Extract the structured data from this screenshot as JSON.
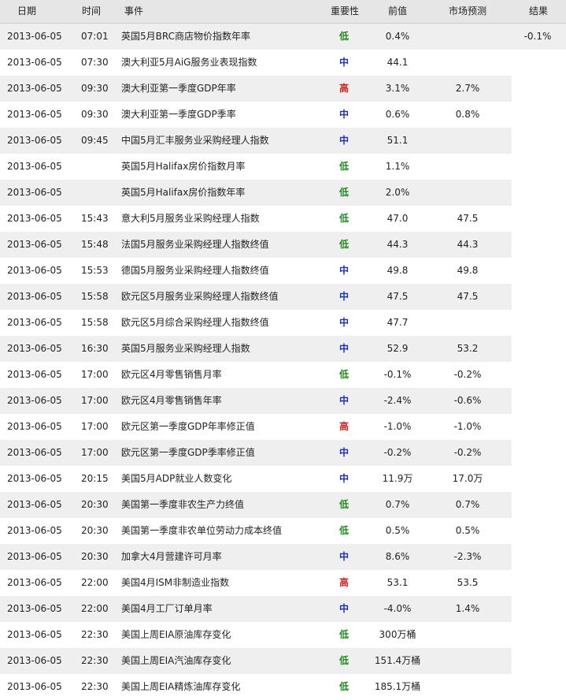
{
  "header": {
    "date": "日期",
    "time": "时间",
    "event": "事件",
    "importance": "重要性",
    "previous": "前值",
    "forecast": "市场预测",
    "result": "结果"
  },
  "importance_colors": {
    "低": "#1d8a1d",
    "中": "#1a2fbb",
    "高": "#d21e1e"
  },
  "rows": [
    {
      "date": "2013-06-05",
      "time": "07:01",
      "event": "英国5月BRC商店物价指数年率",
      "importance": "低",
      "previous": "0.4%",
      "forecast": "",
      "result": "-0.1%"
    },
    {
      "date": "2013-06-05",
      "time": "07:30",
      "event": "澳大利亚5月AiG服务业表现指数",
      "importance": "中",
      "previous": "44.1",
      "forecast": "",
      "result": ""
    },
    {
      "date": "2013-06-05",
      "time": "09:30",
      "event": "澳大利亚第一季度GDP年率",
      "importance": "高",
      "previous": "3.1%",
      "forecast": "2.7%",
      "result": ""
    },
    {
      "date": "2013-06-05",
      "time": "09:30",
      "event": "澳大利亚第一季度GDP季率",
      "importance": "中",
      "previous": "0.6%",
      "forecast": "0.8%",
      "result": ""
    },
    {
      "date": "2013-06-05",
      "time": "09:45",
      "event": "中国5月汇丰服务业采购经理人指数",
      "importance": "中",
      "previous": "51.1",
      "forecast": "",
      "result": ""
    },
    {
      "date": "2013-06-05",
      "time": "",
      "event": "英国5月Halifax房价指数月率",
      "importance": "低",
      "previous": "1.1%",
      "forecast": "",
      "result": ""
    },
    {
      "date": "2013-06-05",
      "time": "",
      "event": "英国5月Halifax房价指数年率",
      "importance": "低",
      "previous": "2.0%",
      "forecast": "",
      "result": ""
    },
    {
      "date": "2013-06-05",
      "time": "15:43",
      "event": "意大利5月服务业采购经理人指数",
      "importance": "低",
      "previous": "47.0",
      "forecast": "47.5",
      "result": ""
    },
    {
      "date": "2013-06-05",
      "time": "15:48",
      "event": "法国5月服务业采购经理人指数终值",
      "importance": "低",
      "previous": "44.3",
      "forecast": "44.3",
      "result": ""
    },
    {
      "date": "2013-06-05",
      "time": "15:53",
      "event": "德国5月服务业采购经理人指数终值",
      "importance": "中",
      "previous": "49.8",
      "forecast": "49.8",
      "result": ""
    },
    {
      "date": "2013-06-05",
      "time": "15:58",
      "event": "欧元区5月服务业采购经理人指数终值",
      "importance": "中",
      "previous": "47.5",
      "forecast": "47.5",
      "result": ""
    },
    {
      "date": "2013-06-05",
      "time": "15:58",
      "event": "欧元区5月综合采购经理人指数终值",
      "importance": "中",
      "previous": "47.7",
      "forecast": "",
      "result": ""
    },
    {
      "date": "2013-06-05",
      "time": "16:30",
      "event": "英国5月服务业采购经理人指数",
      "importance": "中",
      "previous": "52.9",
      "forecast": "53.2",
      "result": ""
    },
    {
      "date": "2013-06-05",
      "time": "17:00",
      "event": "欧元区4月零售销售月率",
      "importance": "低",
      "previous": "-0.1%",
      "forecast": "-0.2%",
      "result": ""
    },
    {
      "date": "2013-06-05",
      "time": "17:00",
      "event": "欧元区4月零售销售年率",
      "importance": "中",
      "previous": "-2.4%",
      "forecast": "-0.6%",
      "result": ""
    },
    {
      "date": "2013-06-05",
      "time": "17:00",
      "event": "欧元区第一季度GDP年率修正值",
      "importance": "高",
      "previous": "-1.0%",
      "forecast": "-1.0%",
      "result": ""
    },
    {
      "date": "2013-06-05",
      "time": "17:00",
      "event": "欧元区第一季度GDP季率修正值",
      "importance": "中",
      "previous": "-0.2%",
      "forecast": "-0.2%",
      "result": ""
    },
    {
      "date": "2013-06-05",
      "time": "20:15",
      "event": "美国5月ADP就业人数变化",
      "importance": "中",
      "previous": "11.9万",
      "forecast": "17.0万",
      "result": ""
    },
    {
      "date": "2013-06-05",
      "time": "20:30",
      "event": "美国第一季度非农生产力终值",
      "importance": "低",
      "previous": "0.7%",
      "forecast": "0.7%",
      "result": ""
    },
    {
      "date": "2013-06-05",
      "time": "20:30",
      "event": "美国第一季度非农单位劳动力成本终值",
      "importance": "低",
      "previous": "0.5%",
      "forecast": "0.5%",
      "result": ""
    },
    {
      "date": "2013-06-05",
      "time": "20:30",
      "event": "加拿大4月营建许可月率",
      "importance": "中",
      "previous": "8.6%",
      "forecast": "-2.3%",
      "result": ""
    },
    {
      "date": "2013-06-05",
      "time": "22:00",
      "event": "美国4月ISM非制造业指数",
      "importance": "高",
      "previous": "53.1",
      "forecast": "53.5",
      "result": ""
    },
    {
      "date": "2013-06-05",
      "time": "22:00",
      "event": "美国4月工厂订单月率",
      "importance": "中",
      "previous": "-4.0%",
      "forecast": "1.4%",
      "result": ""
    },
    {
      "date": "2013-06-05",
      "time": "22:30",
      "event": "美国上周EIA原油库存变化",
      "importance": "低",
      "previous": "300万桶",
      "forecast": "",
      "result": ""
    },
    {
      "date": "2013-06-05",
      "time": "22:30",
      "event": "美国上周EIA汽油库存变化",
      "importance": "低",
      "previous": "151.4万桶",
      "forecast": "",
      "result": ""
    },
    {
      "date": "2013-06-05",
      "time": "22:30",
      "event": "美国上周EIA精炼油库存变化",
      "importance": "低",
      "previous": "185.1万桶",
      "forecast": "",
      "result": ""
    }
  ]
}
